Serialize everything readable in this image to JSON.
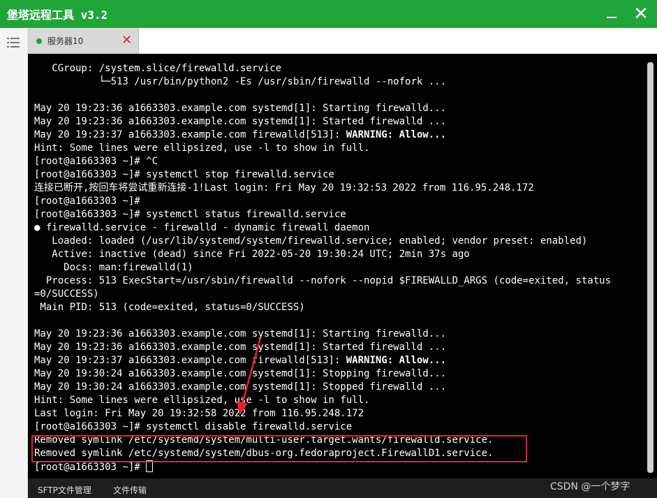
{
  "app": {
    "title": "堡塔远程工具 v3.2"
  },
  "window_controls": {
    "close_glyph": "✕"
  },
  "tabs": [
    {
      "label": "服务器10",
      "status": "connected",
      "close_glyph": "✕"
    }
  ],
  "terminal": {
    "lines": [
      "   CGroup: /system.slice/firewalld.service",
      "           └─513 /usr/bin/python2 -Es /usr/sbin/firewalld --nofork ...",
      "",
      "May 20 19:23:36 a1663303.example.com systemd[1]: Starting firewalld...",
      "May 20 19:23:36 a1663303.example.com systemd[1]: Started firewalld ...",
      "May 20 19:23:37 a1663303.example.com firewalld[513]: WARNING: Allow...",
      "Hint: Some lines were ellipsized, use -l to show in full.",
      "[root@a1663303 ~]# ^C",
      "[root@a1663303 ~]# systemctl stop firewalld.service",
      "连接已断开,按回车将尝试重新连接-1!Last login: Fri May 20 19:32:53 2022 from 116.95.248.172",
      "[root@a1663303 ~]#",
      "[root@a1663303 ~]# systemctl status firewalld.service",
      "● firewalld.service - firewalld - dynamic firewall daemon",
      "   Loaded: loaded (/usr/lib/systemd/system/firewalld.service; enabled; vendor preset: enabled)",
      "   Active: inactive (dead) since Fri 2022-05-20 19:30:24 UTC; 2min 37s ago",
      "     Docs: man:firewalld(1)",
      "  Process: 513 ExecStart=/usr/sbin/firewalld --nofork --nopid $FIREWALLD_ARGS (code=exited, status",
      "=0/SUCCESS)",
      " Main PID: 513 (code=exited, status=0/SUCCESS)",
      "",
      "May 20 19:23:36 a1663303.example.com systemd[1]: Starting firewalld...",
      "May 20 19:23:36 a1663303.example.com systemd[1]: Started firewalld ...",
      "May 20 19:23:37 a1663303.example.com firewalld[513]: WARNING: Allow...",
      "May 20 19:30:24 a1663303.example.com systemd[1]: Stopping firewalld...",
      "May 20 19:30:24 a1663303.example.com systemd[1]: Stopped firewalld ...",
      "Hint: Some lines were ellipsized, use -l to show in full.",
      "Last login: Fri May 20 19:32:58 2022 from 116.95.248.172",
      "[root@a1663303 ~]# systemctl disable firewalld.service",
      "Removed symlink /etc/systemd/system/multi-user.target.wants/firewalld.service.",
      "Removed symlink /etc/systemd/system/dbus-org.fedoraproject.FirewallD1.service.",
      "[root@a1663303 ~]# "
    ]
  },
  "bottom_tabs": {
    "sftp": "SFTP文件管理",
    "transfer": "文件传输"
  },
  "watermark": "CSDN @一个梦字",
  "colors": {
    "titlebar": "#20a53a",
    "terminal_bg": "#000000",
    "terminal_fg": "#ffffff",
    "annotation": "#e8222f",
    "tab_close": "#e0252b"
  }
}
